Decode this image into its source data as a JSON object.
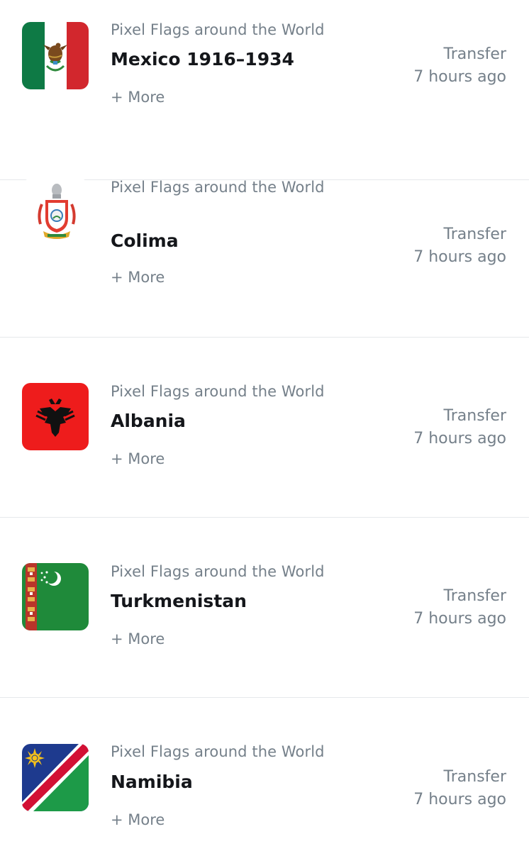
{
  "activity": {
    "items": [
      {
        "flag_icon": "mexico-1916-flag-icon",
        "collection": "Pixel Flags around the World",
        "title": "Mexico 1916–1934",
        "more": "+ More",
        "event": "Transfer",
        "time": "7 hours ago"
      },
      {
        "flag_icon": "colima-coat-of-arms-icon",
        "collection": "Pixel Flags around the World",
        "title": "Colima",
        "more": "+ More",
        "event": "Transfer",
        "time": "7 hours ago"
      },
      {
        "flag_icon": "albania-flag-icon",
        "collection": "Pixel Flags around the World",
        "title": "Albania",
        "more": "+ More",
        "event": "Transfer",
        "time": "7 hours ago"
      },
      {
        "flag_icon": "turkmenistan-flag-icon",
        "collection": "Pixel Flags around the World",
        "title": "Turkmenistan",
        "more": "+ More",
        "event": "Transfer",
        "time": "7 hours ago"
      },
      {
        "flag_icon": "namibia-flag-icon",
        "collection": "Pixel Flags around the World",
        "title": "Namibia",
        "more": "+ More",
        "event": "Transfer",
        "time": "7 hours ago"
      }
    ]
  },
  "colors": {
    "muted_text": "#75808a",
    "title_text": "#14161a",
    "divider": "#e6e8eb"
  }
}
